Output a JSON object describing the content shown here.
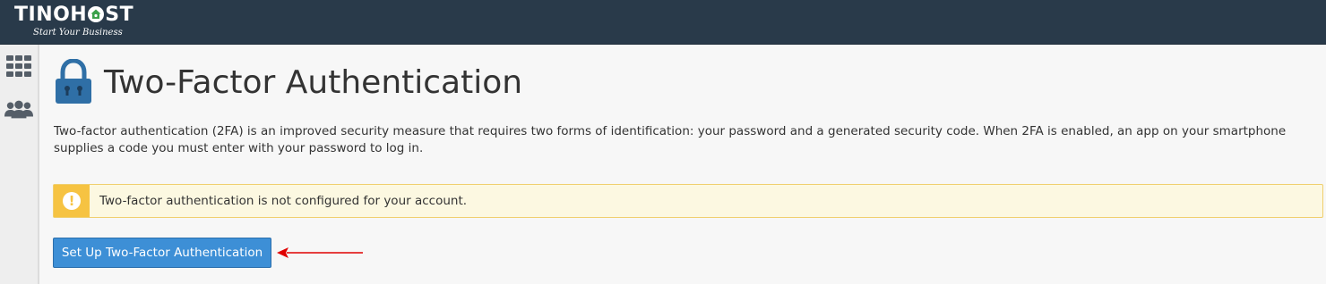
{
  "brand": {
    "name_left": "TINOH",
    "name_right": "ST",
    "tagline": "Start Your Business"
  },
  "sidebar": {
    "items": [
      {
        "icon": "grid-icon"
      },
      {
        "icon": "users-icon"
      }
    ]
  },
  "page": {
    "title": "Two-Factor Authentication",
    "title_icon": "lock-icon",
    "description": "Two-factor authentication (2FA) is an improved security measure that requires two forms of identification: your password and a generated security code. When 2FA is enabled, an app on your smartphone supplies a code you must enter with your password to log in."
  },
  "alert": {
    "icon": "exclamation-icon",
    "icon_glyph": "!",
    "message": "Two-factor authentication is not configured for your account."
  },
  "actions": {
    "setup_label": "Set Up Two-Factor Authentication"
  },
  "colors": {
    "topbar": "#293a4a",
    "primary_button": "#3d8fd6",
    "warning": "#f6c342",
    "warning_bg": "#fcf8e1",
    "lock_icon": "#2f6fa6",
    "annotation_arrow": "#e00000"
  }
}
